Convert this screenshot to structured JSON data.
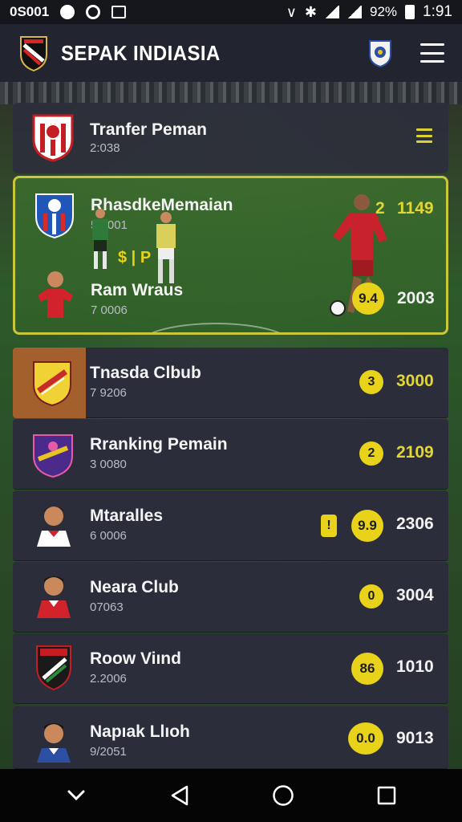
{
  "status_bar": {
    "left_text": "0S001",
    "battery": "92%",
    "time": "1:91"
  },
  "header": {
    "title": "SEPAK INDIASIA",
    "logo_icon": "club-crest-icon",
    "badge_icon": "league-badge-icon",
    "menu_icon": "hamburger-menu-icon"
  },
  "top_card": {
    "title": "Tranfer Peman",
    "subtitle": "2:038"
  },
  "featured": {
    "title": "RhasdkeMemaian",
    "subtitle": "5:0001",
    "mid_label": "$ | P",
    "right_rank": "2",
    "right_score": "1149",
    "bottom_title": "Ram Wraus",
    "bottom_subtitle": "7 0006",
    "bottom_badge": "9.4",
    "bottom_score": "2003"
  },
  "list": [
    {
      "title": "Tnasda Clbub",
      "subtitle": "7 9206",
      "badge": "3",
      "score": "3000",
      "score_yellow": true
    },
    {
      "title": "Rranking Pemain",
      "subtitle": "3 0080",
      "badge": "2",
      "score": "2109",
      "score_yellow": true
    },
    {
      "title": "Mtaralles",
      "subtitle": "6 0006",
      "badge_small": "!",
      "badge": "9.9",
      "score": "2306",
      "score_yellow": false
    },
    {
      "title": "Neara Club",
      "subtitle": "07063",
      "badge": "0",
      "score": "3004",
      "score_yellow": false
    },
    {
      "title": "Roow Viınd",
      "subtitle": "2.2006",
      "badge": "86",
      "score": "1010",
      "score_yellow": false
    },
    {
      "title": "Napıak Llıoh",
      "subtitle": "9/2051",
      "badge": "0.0",
      "score": "9013",
      "score_yellow": false
    }
  ],
  "colors": {
    "accent_yellow": "#e8d21a",
    "card_bg": "#2c2f3b",
    "header_bg": "#22252f"
  }
}
